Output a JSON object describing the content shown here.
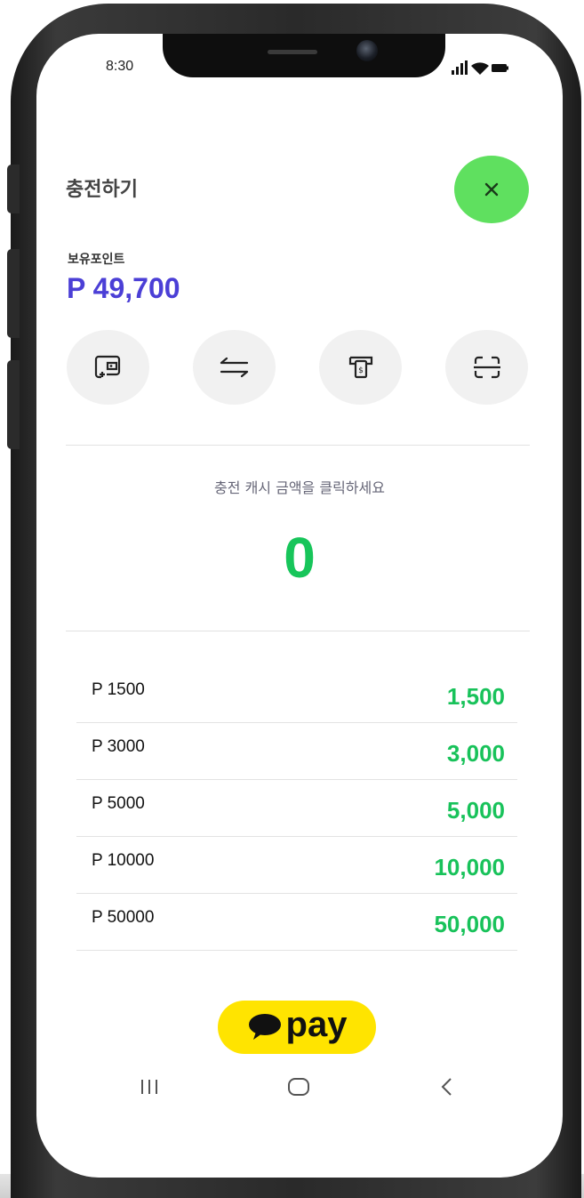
{
  "status_bar": {
    "time": "8:30"
  },
  "header": {
    "title": "충전하기",
    "close_icon": "close-icon",
    "accent_color": "#5fe05f"
  },
  "points": {
    "label": "보유포인트",
    "value": "P 49,700",
    "color": "#4b3fd6"
  },
  "quick_actions": [
    {
      "icon": "wallet-add-icon"
    },
    {
      "icon": "transfer-arrows-icon"
    },
    {
      "icon": "atm-withdraw-icon"
    },
    {
      "icon": "scan-icon"
    }
  ],
  "charge": {
    "hint": "충전 캐시 금액을 클릭하세요",
    "amount": "0",
    "amount_color": "#17c55a"
  },
  "options": [
    {
      "label": "P 1500",
      "value": "1,500"
    },
    {
      "label": "P 3000",
      "value": "3,000"
    },
    {
      "label": "P 5000",
      "value": "5,000"
    },
    {
      "label": "P 10000",
      "value": "10,000"
    },
    {
      "label": "P 50000",
      "value": "50,000"
    }
  ],
  "payment": {
    "label": "pay",
    "color": "#ffe400"
  },
  "nav_bar": {
    "icons": [
      "recent-apps-icon",
      "home-icon",
      "back-icon"
    ]
  }
}
